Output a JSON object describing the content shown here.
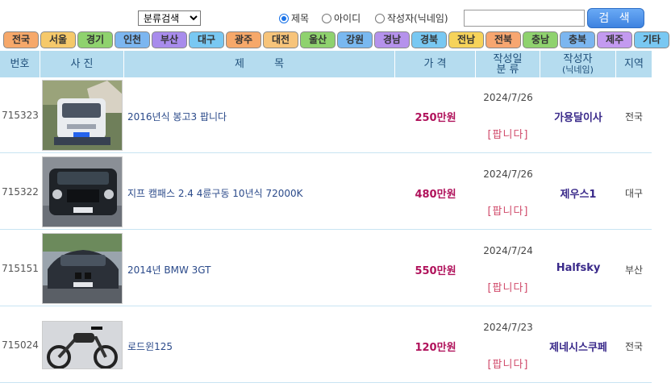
{
  "search": {
    "category_label": "분류검색",
    "options": [
      "제목",
      "아이디",
      "작성자(닉네임)"
    ],
    "selected_option": "제목",
    "query_value": "",
    "button_label": "검 색"
  },
  "regions": [
    {
      "label": "전국",
      "color": "#f6a86a"
    },
    {
      "label": "서울",
      "color": "#f6c96a"
    },
    {
      "label": "경기",
      "color": "#8fd26e"
    },
    {
      "label": "인천",
      "color": "#7cb6f0"
    },
    {
      "label": "부산",
      "color": "#a88cec"
    },
    {
      "label": "대구",
      "color": "#79c8f2"
    },
    {
      "label": "광주",
      "color": "#f6a86a"
    },
    {
      "label": "대전",
      "color": "#f7c47a"
    },
    {
      "label": "울산",
      "color": "#8fd26e"
    },
    {
      "label": "강원",
      "color": "#79b8f0"
    },
    {
      "label": "경남",
      "color": "#b592ec"
    },
    {
      "label": "경북",
      "color": "#79c8f2"
    },
    {
      "label": "전남",
      "color": "#f6d35a"
    },
    {
      "label": "전북",
      "color": "#f7a670"
    },
    {
      "label": "충남",
      "color": "#8fd26e"
    },
    {
      "label": "충북",
      "color": "#7cb6f0"
    },
    {
      "label": "제주",
      "color": "#c39af0"
    },
    {
      "label": "기타",
      "color": "#79c8f2"
    }
  ],
  "table": {
    "headers": {
      "number": "번호",
      "photo": "사 진",
      "title": "제         목",
      "price": "가 격",
      "date": "작성일",
      "category": "분 류",
      "author": "작성자",
      "author_sub": "(닉네임)",
      "region": "지역"
    },
    "rows": [
      {
        "number": "715323",
        "title": "2016년식 봉고3 팝니다",
        "price": "250만원",
        "date": "2024/7/26",
        "tag": "[팝니다]",
        "author": "가용달이사",
        "region": "전국"
      },
      {
        "number": "715322",
        "title": "지프 캠패스 2.4 4륜구동 10년식 72000K",
        "price": "480만원",
        "date": "2024/7/26",
        "tag": "[팝니다]",
        "author": "제우스1",
        "region": "대구"
      },
      {
        "number": "715151",
        "title": "2014년 BMW 3GT",
        "price": "550만원",
        "date": "2024/7/24",
        "tag": "[팝니다]",
        "author": "Halfsky",
        "region": "부산"
      },
      {
        "number": "715024",
        "title": "로드윈125",
        "price": "120만원",
        "date": "2024/7/23",
        "tag": "[팝니다]",
        "author": "제네시스쿠페",
        "region": "전국"
      }
    ]
  }
}
